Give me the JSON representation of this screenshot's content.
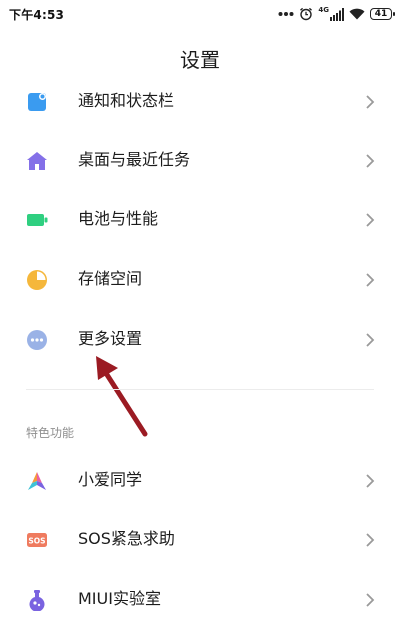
{
  "status_bar": {
    "time": "下午4:53",
    "network_label": "4G",
    "battery_level": "41"
  },
  "header": {
    "title": "设置"
  },
  "settings": {
    "items": [
      {
        "label": "通知和状态栏",
        "icon": "notification-icon",
        "color": "#3a9bf0"
      },
      {
        "label": "桌面与最近任务",
        "icon": "home-icon",
        "color": "#8470e8"
      },
      {
        "label": "电池与性能",
        "icon": "battery-icon",
        "color": "#2fcf80"
      },
      {
        "label": "存储空间",
        "icon": "storage-pie-icon",
        "color": "#f5b73b"
      },
      {
        "label": "更多设置",
        "icon": "more-dots-icon",
        "color": "#9ab2e6"
      }
    ]
  },
  "features": {
    "section_title": "特色功能",
    "items": [
      {
        "label": "小爱同学",
        "icon": "xiaoai-icon"
      },
      {
        "label": "SOS紧急求助",
        "icon": "sos-icon",
        "icon_text": "SOS",
        "color": "#ef7b5f"
      },
      {
        "label": "MIUI实验室",
        "icon": "lab-flask-icon",
        "color": "#7a63e0"
      }
    ]
  },
  "annotation": {
    "arrow_color": "#9b1b23",
    "points_to": "更多设置"
  }
}
